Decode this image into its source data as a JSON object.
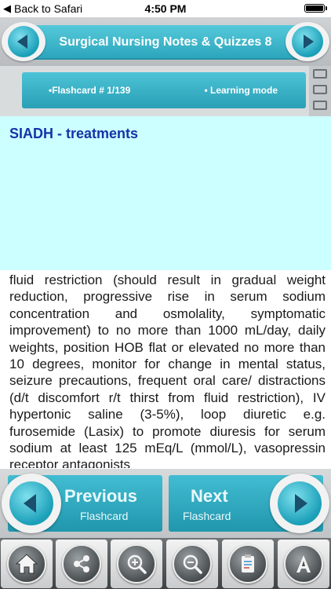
{
  "status_bar": {
    "back_label": "Back to Safari",
    "time": "4:50 PM"
  },
  "header": {
    "title": "Surgical Nursing Notes & Quizzes 8"
  },
  "flashcard_info": {
    "counter": "•Flashcard # 1/139",
    "mode": "• Learning mode"
  },
  "card": {
    "question": "SIADH - treatments",
    "answer": "fluid restriction (should result in gradual weight reduction, progressive rise in serum sodium concentration and osmolality, symptomatic improvement) to no more than 1000 mL/day, daily weights, position HOB flat or elevated no more than 10 degrees, monitor for change in mental status, seizure precautions, frequent oral care/ distractions (d/t discomfort r/t thirst from fluid restriction), IV hypertonic saline (3-5%), loop diuretic e.g. furosemide (Lasix) to promote diuresis for serum sodium at least 125 mEq/L (mmol/L), vasopressin receptor antagonists"
  },
  "navigation": {
    "previous_label": "Previous",
    "previous_sub": "Flashcard",
    "next_label": "Next",
    "next_sub": "Flashcard"
  },
  "toolbar": {
    "items": [
      "home-icon",
      "share-icon",
      "zoom-in-icon",
      "zoom-out-icon",
      "clipboard-icon",
      "font-icon"
    ]
  },
  "colors": {
    "accent": "#2aa4bb",
    "question_bg": "#ccffff",
    "question_text": "#1633a8"
  }
}
